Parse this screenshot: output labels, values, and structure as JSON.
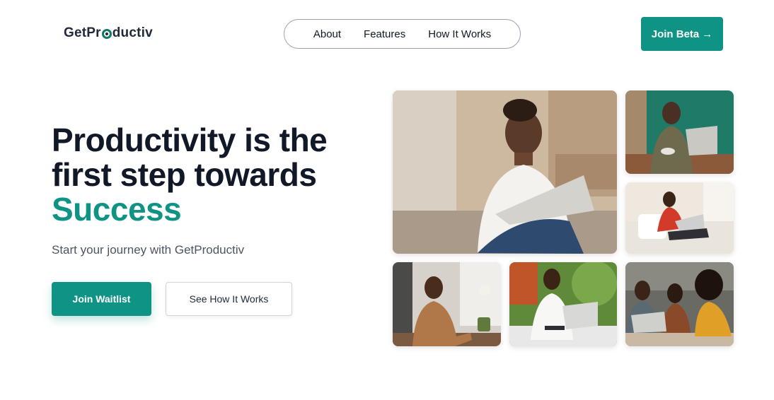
{
  "header": {
    "logo_prefix": "GetPr",
    "logo_suffix": "ductiv",
    "nav": [
      "About",
      "Features",
      "How It Works"
    ],
    "beta_label": "Join Beta",
    "beta_arrow": "→"
  },
  "hero": {
    "title_line1": "Productivity is the",
    "title_line2": "first step towards",
    "title_accent": "Success",
    "subtitle": "Start your journey with GetProductiv",
    "primary_button": "Join Waitlist",
    "secondary_button": "See How It Works"
  },
  "colors": {
    "brand": "#0f9384",
    "text": "#111827",
    "muted": "#4b5563"
  },
  "gallery": [
    "photo-woman-laptop-outdoor",
    "photo-woman-laptop-cafe",
    "photo-woman-laptop-sofa",
    "photo-man-laptop-desk",
    "photo-woman-laptop-garden",
    "photo-group-laptop-cafe"
  ]
}
